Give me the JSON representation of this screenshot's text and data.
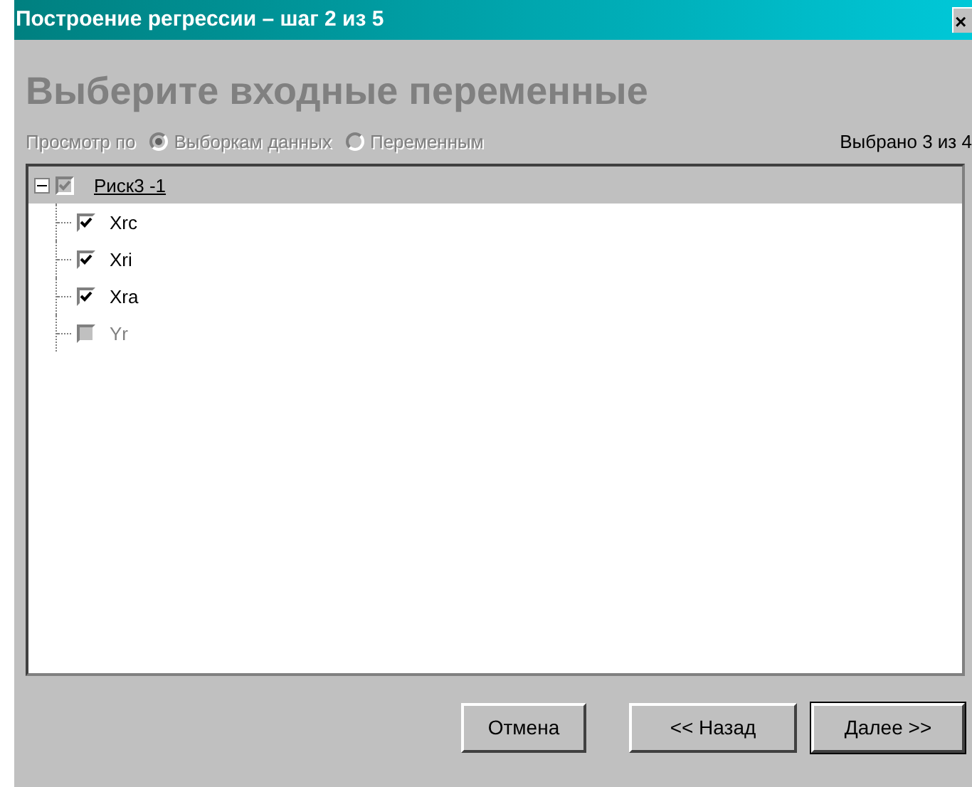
{
  "window": {
    "title": "Построение регрессии – шаг 2 из 5",
    "close": "×"
  },
  "heading": "Выберите входные переменные",
  "view_by": {
    "label": "Просмотр по",
    "disabled": true,
    "options": [
      {
        "label": "Выборкам данных",
        "selected": true
      },
      {
        "label": "Переменным",
        "selected": false
      }
    ]
  },
  "selection_count": "Выбрано 3 из 4",
  "tree": [
    {
      "label": "Риск3 -1",
      "expanded": true,
      "checked": true,
      "disabled": true,
      "children": [
        {
          "label": "Xrc",
          "checked": true,
          "disabled": false
        },
        {
          "label": "Xri",
          "checked": true,
          "disabled": false
        },
        {
          "label": "Xra",
          "checked": true,
          "disabled": false
        },
        {
          "label": "Yr",
          "checked": false,
          "disabled": true
        }
      ]
    }
  ],
  "buttons": [
    {
      "label": "Отмена",
      "default": false
    },
    {
      "label": "<< Назад",
      "default": false
    },
    {
      "label": "Далее >>",
      "default": true
    }
  ]
}
